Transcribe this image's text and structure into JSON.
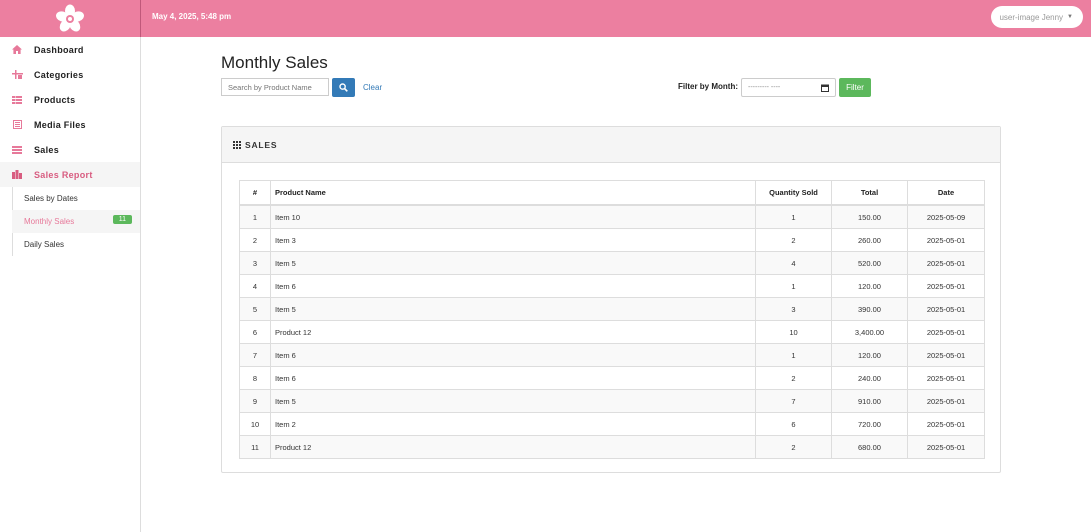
{
  "header": {
    "datetime": "May 4, 2025, 5:48 pm",
    "user_image_alt": "user-image",
    "user_name": "Jenny"
  },
  "sidebar": {
    "items": [
      {
        "label": "Dashboard",
        "icon": "home-icon"
      },
      {
        "label": "Categories",
        "icon": "categories-icon"
      },
      {
        "label": "Products",
        "icon": "products-grid-icon"
      },
      {
        "label": "Media Files",
        "icon": "media-files-icon"
      },
      {
        "label": "Sales",
        "icon": "sales-list-icon"
      },
      {
        "label": "Sales Report",
        "icon": "report-icon"
      }
    ],
    "submenu": [
      {
        "label": "Sales by Dates"
      },
      {
        "label": "Monthly Sales",
        "badge": "11"
      },
      {
        "label": "Daily Sales"
      }
    ]
  },
  "page": {
    "title": "Monthly Sales",
    "search_placeholder": "Search by Product Name",
    "clear_label": "Clear",
    "filter_label": "Filter by Month:",
    "month_placeholder": "--------- ----",
    "filter_button": "Filter"
  },
  "panel": {
    "heading": "SALES",
    "columns": [
      "#",
      "Product Name",
      "Quantity Sold",
      "Total",
      "Date"
    ],
    "rows": [
      [
        "1",
        "Item 10",
        "1",
        "150.00",
        "2025-05-09"
      ],
      [
        "2",
        "Item 3",
        "2",
        "260.00",
        "2025-05-01"
      ],
      [
        "3",
        "Item 5",
        "4",
        "520.00",
        "2025-05-01"
      ],
      [
        "4",
        "Item 6",
        "1",
        "120.00",
        "2025-05-01"
      ],
      [
        "5",
        "Item 5",
        "3",
        "390.00",
        "2025-05-01"
      ],
      [
        "6",
        "Product 12",
        "10",
        "3,400.00",
        "2025-05-01"
      ],
      [
        "7",
        "Item 6",
        "1",
        "120.00",
        "2025-05-01"
      ],
      [
        "8",
        "Item 6",
        "2",
        "240.00",
        "2025-05-01"
      ],
      [
        "9",
        "Item 5",
        "7",
        "910.00",
        "2025-05-01"
      ],
      [
        "10",
        "Item 2",
        "6",
        "720.00",
        "2025-05-01"
      ],
      [
        "11",
        "Product 12",
        "2",
        "680.00",
        "2025-05-01"
      ]
    ]
  },
  "colors": {
    "brand_pink": "#ec7fa0",
    "active_pink": "#d85c80",
    "primary_blue": "#337ab7",
    "success_green": "#5cb85c"
  }
}
